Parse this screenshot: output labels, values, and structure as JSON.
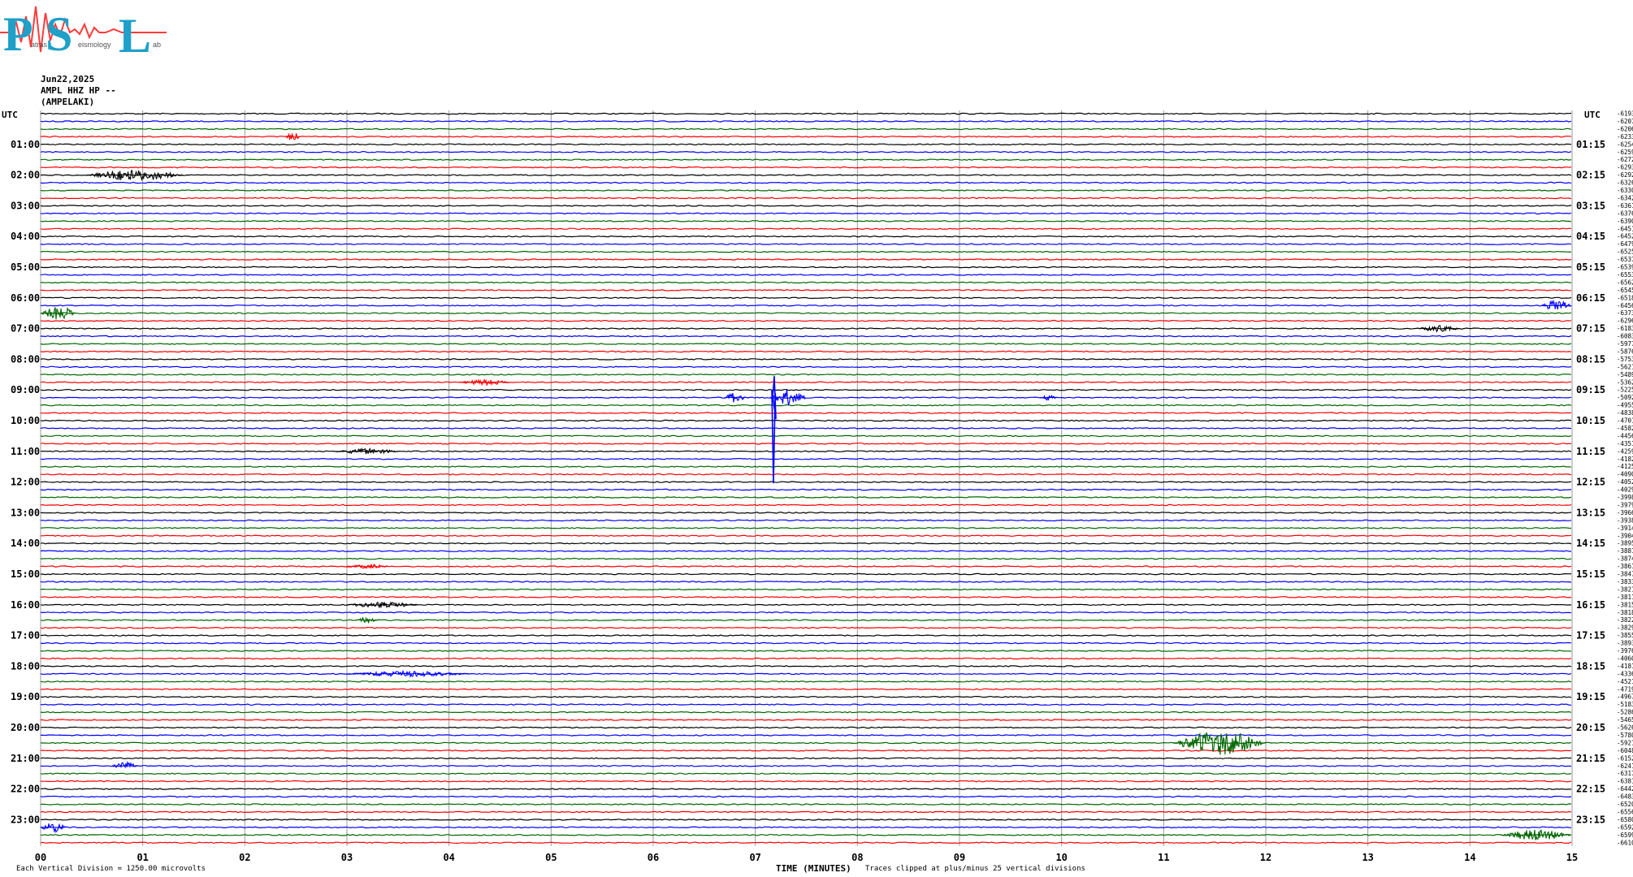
{
  "header": {
    "logo_letters": [
      "P",
      "S",
      "L"
    ],
    "logo_words": [
      "atras",
      "eismology",
      "ab"
    ],
    "date": "Jun22,2025",
    "station": "AMPL HHZ HP --",
    "site": "(AMPELAKI)"
  },
  "colors": {
    "black": "#000000",
    "red": "#ff0000",
    "blue": "#0000ff",
    "green": "#006600",
    "logo": "#1ea0c8",
    "logo_wave": "#ff3b3b"
  },
  "footer": {
    "left_note": "Each Vertical Division = 1250.00 microvolts",
    "x_title": "TIME (MINUTES)",
    "right_note": "Traces clipped at plus/minus 25 vertical divisions"
  },
  "chart_data": {
    "type": "line",
    "title": "",
    "xlabel": "TIME (MINUTES)",
    "ylabel": "UTC",
    "xlim": [
      0,
      15
    ],
    "x_ticks": [
      "00",
      "01",
      "02",
      "03",
      "04",
      "05",
      "06",
      "07",
      "08",
      "09",
      "10",
      "11",
      "12",
      "13",
      "14",
      "15"
    ],
    "left_axis_title": "UTC",
    "right_axis_title": "UTC",
    "left_labels": [
      "01:00",
      "02:00",
      "03:00",
      "04:00",
      "05:00",
      "06:00",
      "07:00",
      "08:00",
      "09:00",
      "10:00",
      "11:00",
      "12:00",
      "13:00",
      "14:00",
      "15:00",
      "16:00",
      "17:00",
      "18:00",
      "19:00",
      "20:00",
      "21:00",
      "22:00",
      "23:00"
    ],
    "right_labels": [
      "01:15",
      "02:15",
      "03:15",
      "04:15",
      "05:15",
      "06:15",
      "07:15",
      "08:15",
      "09:15",
      "10:15",
      "11:15",
      "12:15",
      "13:15",
      "14:15",
      "15:15",
      "16:15",
      "17:15",
      "18:15",
      "19:15",
      "20:15",
      "21:15",
      "22:15",
      "23:15"
    ],
    "trace_count": 96,
    "trace_color_cycle": [
      "black",
      "blue",
      "green",
      "red"
    ],
    "trace_offsets": [
      "-6193",
      "-6207",
      "-6206",
      "-6233",
      "-6254",
      "-6259",
      "-6272",
      "-6293",
      "-6292",
      "-6326",
      "-6330",
      "-6342",
      "-6361",
      "-6376",
      "-6390",
      "-6451",
      "-6452",
      "-6479",
      "-6525",
      "-6537",
      "-6539",
      "-6553",
      "-6562",
      "-6545",
      "-6518",
      "-6456",
      "-6373",
      "-6296",
      "-6183",
      "-6083",
      "-5977",
      "-5876",
      "-5753",
      "-5621",
      "-5489",
      "-5362",
      "-5225",
      "-5092",
      "-4955",
      "-4838",
      "-4701",
      "-4582",
      "-4456",
      "-4351",
      "-4259",
      "-4182",
      "-4125",
      "-4090",
      "-4052",
      "-4029",
      "-3998",
      "-3979",
      "-3966",
      "-3938",
      "-3914",
      "-3904",
      "-3895",
      "-3881",
      "-3874",
      "-3861",
      "-3847",
      "-3833",
      "-3821",
      "-3811",
      "-3815",
      "-3818",
      "-3822",
      "-3829",
      "-3855",
      "-3893",
      "-3976",
      "-4060",
      "-4181",
      "-4336",
      "-4521",
      "-4719",
      "-4967",
      "-5183",
      "-5286",
      "-5465",
      "-5626",
      "-5780",
      "-5921",
      "-6048",
      "-6152",
      "-6241",
      "-6317",
      "-6381",
      "-6442",
      "-6483",
      "-6520",
      "-6556",
      "-6580",
      "-6592",
      "-6599",
      "-6610"
    ],
    "events": [
      {
        "trace": 3,
        "t0": 2.4,
        "t1": 2.55,
        "amp": 1.2
      },
      {
        "trace": 8,
        "t0": 0.45,
        "t1": 1.4,
        "amp": 1.6
      },
      {
        "trace": 25,
        "t0": 14.7,
        "t1": 15.0,
        "amp": 1.5
      },
      {
        "trace": 26,
        "t0": 0.0,
        "t1": 0.35,
        "amp": 2.0
      },
      {
        "trace": 28,
        "t0": 13.5,
        "t1": 13.9,
        "amp": 1.0
      },
      {
        "trace": 35,
        "t0": 4.1,
        "t1": 4.6,
        "amp": 0.8
      },
      {
        "trace": 37,
        "t0": 6.7,
        "t1": 6.9,
        "amp": 1.5
      },
      {
        "trace": 37,
        "t0": 7.15,
        "t1": 7.5,
        "amp": 2.5
      },
      {
        "trace": 37,
        "t0": 9.8,
        "t1": 9.95,
        "amp": 0.8
      },
      {
        "trace": 44,
        "t0": 2.9,
        "t1": 3.5,
        "amp": 0.8
      },
      {
        "trace": 59,
        "t0": 3.0,
        "t1": 3.4,
        "amp": 0.8
      },
      {
        "trace": 64,
        "t0": 3.0,
        "t1": 3.7,
        "amp": 0.8
      },
      {
        "trace": 66,
        "t0": 3.1,
        "t1": 3.3,
        "amp": 1.0
      },
      {
        "trace": 73,
        "t0": 3.0,
        "t1": 4.2,
        "amp": 0.8
      },
      {
        "trace": 82,
        "t0": 11.1,
        "t1": 12.0,
        "amp": 3.5
      },
      {
        "trace": 85,
        "t0": 0.7,
        "t1": 0.95,
        "amp": 1.2
      },
      {
        "trace": 93,
        "t0": 0.0,
        "t1": 0.25,
        "amp": 1.5
      },
      {
        "trace": 94,
        "t0": 14.3,
        "t1": 15.0,
        "amp": 1.5
      }
    ],
    "spike": {
      "trace": 37,
      "t": 7.17,
      "up_divisions": 1.4,
      "down_divisions": 3.1
    }
  }
}
